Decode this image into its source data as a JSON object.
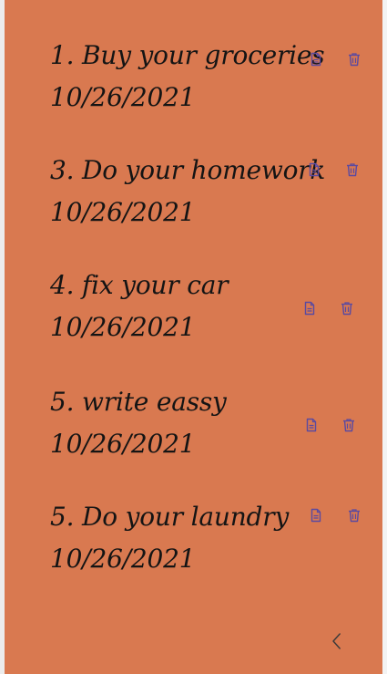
{
  "colors": {
    "background": "#d97950",
    "text": "#141414",
    "icon": "#5b4aa0"
  },
  "todos": [
    {
      "title": "1. Buy your groceries",
      "date": "10/26/2021",
      "edit_icon": "document-icon",
      "delete_icon": "trash-icon"
    },
    {
      "title": "3. Do your homework",
      "date": "10/26/2021",
      "edit_icon": "document-icon",
      "delete_icon": "trash-icon"
    },
    {
      "title": "4. fix your car",
      "date": "10/26/2021",
      "edit_icon": "document-icon",
      "delete_icon": "trash-icon"
    },
    {
      "title": "5. write eassy",
      "date": "10/26/2021",
      "edit_icon": "document-icon",
      "delete_icon": "trash-icon"
    },
    {
      "title": "5. Do your laundry",
      "date": "10/26/2021",
      "edit_icon": "document-icon",
      "delete_icon": "trash-icon"
    }
  ],
  "nav": {
    "back_icon": "chevron-left-icon"
  }
}
